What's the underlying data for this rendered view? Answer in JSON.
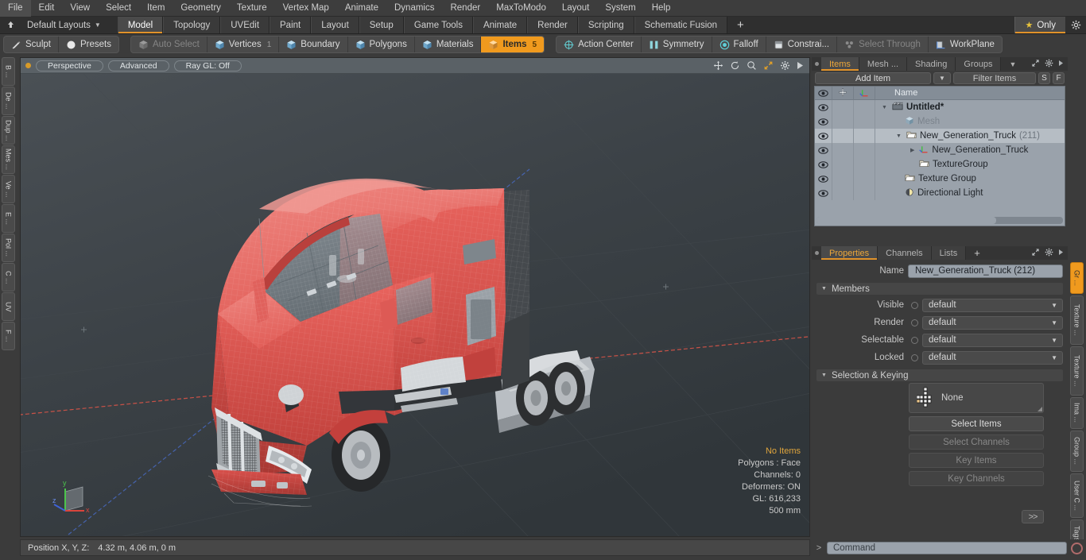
{
  "menu": {
    "items": [
      "File",
      "Edit",
      "View",
      "Select",
      "Item",
      "Geometry",
      "Texture",
      "Vertex Map",
      "Animate",
      "Dynamics",
      "Render",
      "MaxToModo",
      "Layout",
      "System",
      "Help"
    ]
  },
  "layout_row": {
    "layout_name": "Default Layouts",
    "caret": "▼",
    "tabs": [
      {
        "label": "Model",
        "active": true
      },
      {
        "label": "Topology",
        "active": false
      },
      {
        "label": "UVEdit",
        "active": false
      },
      {
        "label": "Paint",
        "active": false
      },
      {
        "label": "Layout",
        "active": false
      },
      {
        "label": "Setup",
        "active": false
      },
      {
        "label": "Game Tools",
        "active": false
      },
      {
        "label": "Animate",
        "active": false
      },
      {
        "label": "Render",
        "active": false
      },
      {
        "label": "Scripting",
        "active": false
      },
      {
        "label": "Schematic Fusion",
        "active": false
      }
    ],
    "add_tab": "+",
    "only_label": "Only",
    "only_star": "★"
  },
  "modebar": {
    "group1": [
      {
        "label": "Sculpt",
        "icon": "pencil-icon",
        "state": "normal"
      },
      {
        "label": "Presets",
        "icon": "sphere-icon",
        "state": "normal"
      }
    ],
    "group2": [
      {
        "label": "Auto Select",
        "icon": "cube-icon",
        "state": "dim",
        "count": ""
      },
      {
        "label": "Vertices",
        "icon": "cube-icon",
        "state": "normal",
        "count": "1"
      },
      {
        "label": "Boundary",
        "icon": "cube-icon",
        "state": "normal",
        "count": ""
      },
      {
        "label": "Polygons",
        "icon": "cube-icon",
        "state": "normal",
        "count": ""
      },
      {
        "label": "Materials",
        "icon": "cube-icon",
        "state": "normal",
        "count": ""
      },
      {
        "label": "Items",
        "icon": "cube-icon",
        "state": "selected",
        "count": "5"
      }
    ],
    "group3": [
      {
        "label": "Action Center",
        "icon": "target-icon",
        "state": "normal"
      },
      {
        "label": "Symmetry",
        "icon": "symmetry-icon",
        "state": "normal"
      },
      {
        "label": "Falloff",
        "icon": "falloff-icon",
        "state": "normal"
      },
      {
        "label": "Constrai...",
        "icon": "constraint-icon",
        "state": "normal"
      },
      {
        "label": "Select Through",
        "icon": "select-through-icon",
        "state": "dim"
      },
      {
        "label": "WorkPlane",
        "icon": "workplane-icon",
        "state": "normal"
      }
    ]
  },
  "left_rail": {
    "tabs": [
      "B ...",
      "De ...",
      "Dup ...",
      "Mes ...",
      "Ve ...",
      "E ...",
      "Pol ...",
      "C ...",
      "UV",
      "F ..."
    ]
  },
  "viewport": {
    "pills": [
      "Perspective",
      "Advanced",
      "Ray GL: Off"
    ],
    "icons": [
      "move-icon",
      "rotate-icon",
      "zoom-icon",
      "maximize-icon",
      "gear-icon",
      "play-icon"
    ],
    "stats": [
      "No Items",
      "Polygons : Face",
      "Channels: 0",
      "Deformers: ON",
      "GL: 616,233",
      "500 mm"
    ],
    "axis_labels": {
      "x": "x",
      "y": "y",
      "z": "z"
    }
  },
  "statusbar": {
    "position_label": "Position X, Y, Z:",
    "position_value": "4.32 m, 4.06 m, 0 m"
  },
  "items_panel": {
    "tabs": [
      {
        "label": "Items",
        "active": true
      },
      {
        "label": "Mesh ...",
        "active": false
      },
      {
        "label": "Shading",
        "active": false
      },
      {
        "label": "Groups",
        "active": false
      }
    ],
    "tab_chevron": "▼",
    "toolbar": {
      "add_item": "Add Item",
      "add_item_dd": "▼",
      "filter_placeholder": "Filter Items",
      "btn_s": "S",
      "btn_f": "F"
    },
    "columns": {
      "eye": "eye-icon",
      "c2": "move-icon",
      "c3": "axis-icon",
      "name": "Name"
    },
    "rows": [
      {
        "name": "Untitled*",
        "count": "",
        "icon": "scene-icon",
        "indent": 0,
        "bold": true,
        "dim": false,
        "selected": false,
        "expander": "▼"
      },
      {
        "name": "Mesh",
        "count": "",
        "icon": "mesh-icon",
        "indent": 1,
        "bold": false,
        "dim": true,
        "selected": false,
        "expander": ""
      },
      {
        "name": "New_Generation_Truck",
        "count": "(211)",
        "icon": "group-icon",
        "indent": 1,
        "bold": false,
        "dim": false,
        "selected": true,
        "expander": "▼"
      },
      {
        "name": "New_Generation_Truck",
        "count": "",
        "icon": "locator-icon",
        "indent": 2,
        "bold": false,
        "dim": false,
        "selected": false,
        "expander": "▶"
      },
      {
        "name": "TextureGroup",
        "count": "",
        "icon": "group-icon",
        "indent": 2,
        "bold": false,
        "dim": false,
        "selected": false,
        "expander": ""
      },
      {
        "name": "Texture Group",
        "count": "",
        "icon": "group-icon",
        "indent": 1,
        "bold": false,
        "dim": false,
        "selected": false,
        "expander": ""
      },
      {
        "name": "Directional Light",
        "count": "",
        "icon": "light-icon",
        "indent": 1,
        "bold": false,
        "dim": false,
        "selected": false,
        "expander": ""
      }
    ]
  },
  "properties_panel": {
    "tabs": [
      {
        "label": "Properties",
        "active": true
      },
      {
        "label": "Channels",
        "active": false
      },
      {
        "label": "Lists",
        "active": false
      }
    ],
    "add_tab": "+",
    "name_label": "Name",
    "name_value": "New_Generation_Truck (212)",
    "members_header": "Members",
    "members_tri": "▼",
    "members": [
      {
        "label": "Visible",
        "value": "default"
      },
      {
        "label": "Render",
        "value": "default"
      },
      {
        "label": "Selectable",
        "value": "default"
      },
      {
        "label": "Locked",
        "value": "default"
      }
    ],
    "selection_header": "Selection & Keying",
    "selection_tri": "▼",
    "selection_value": "None",
    "buttons": [
      {
        "label": "Select Items",
        "disabled": false
      },
      {
        "label": "Select Channels",
        "disabled": true
      },
      {
        "label": "Key Items",
        "disabled": true
      },
      {
        "label": "Key Channels",
        "disabled": true
      }
    ],
    "more_button": ">>"
  },
  "right_rail": {
    "tabs": [
      {
        "label": "Gr ...",
        "active": true
      },
      {
        "label": "Texture ...",
        "active": false
      },
      {
        "label": "Texture ...",
        "active": false
      },
      {
        "label": "Ima ...",
        "active": false
      },
      {
        "label": "Group ...",
        "active": false
      },
      {
        "label": "User C ...",
        "active": false
      },
      {
        "label": "Tags",
        "active": false
      }
    ]
  },
  "command_bar": {
    "prompt": ">",
    "placeholder": "Command",
    "record_icon": "record-icon"
  },
  "colors": {
    "accent_orange": "#f09a1e",
    "tab_underline": "#e0922a",
    "status_highlight": "#e0a53c",
    "truck_red": "#e05a55",
    "panel_bg": "#3b3b3b",
    "tree_bg": "#9aa2ab",
    "viewport_bg": "#3c4246",
    "axis_x": "#d95448",
    "axis_y": "#5ac45a",
    "axis_z": "#4a6fd0"
  }
}
